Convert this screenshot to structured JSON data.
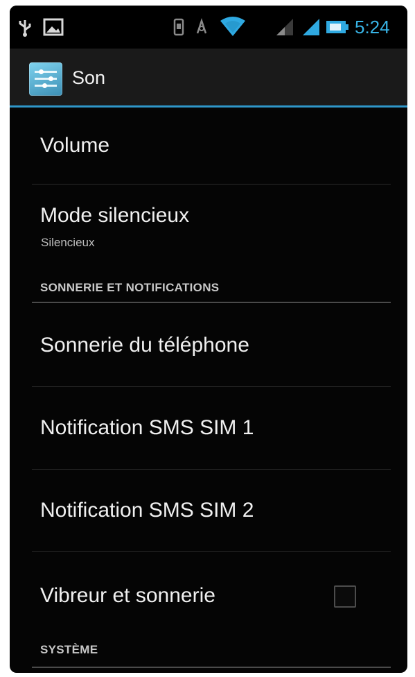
{
  "status_bar": {
    "time": "5:24",
    "icons": [
      "usb-icon",
      "image-icon",
      "sim-icon",
      "nfc-icon",
      "wifi-icon",
      "signal-icon",
      "signal-icon",
      "battery-icon"
    ],
    "time_color": "#38b4e6"
  },
  "action_bar": {
    "title": "Son",
    "icon": "sound-settings-icon",
    "accent_color": "#2f97c9"
  },
  "preferences": {
    "volume": {
      "title": "Volume"
    },
    "silent_mode": {
      "title": "Mode silencieux",
      "summary": "Silencieux"
    },
    "section_ringtone": {
      "title": "SONNERIE ET NOTIFICATIONS"
    },
    "phone_ringtone": {
      "title": "Sonnerie du téléphone"
    },
    "sms_sim1": {
      "title": "Notification SMS SIM 1"
    },
    "sms_sim2": {
      "title": "Notification SMS SIM 2"
    },
    "vibrate_ring": {
      "title": "Vibreur et sonnerie",
      "checked": false
    },
    "section_system": {
      "title": "SYSTÈME"
    }
  }
}
